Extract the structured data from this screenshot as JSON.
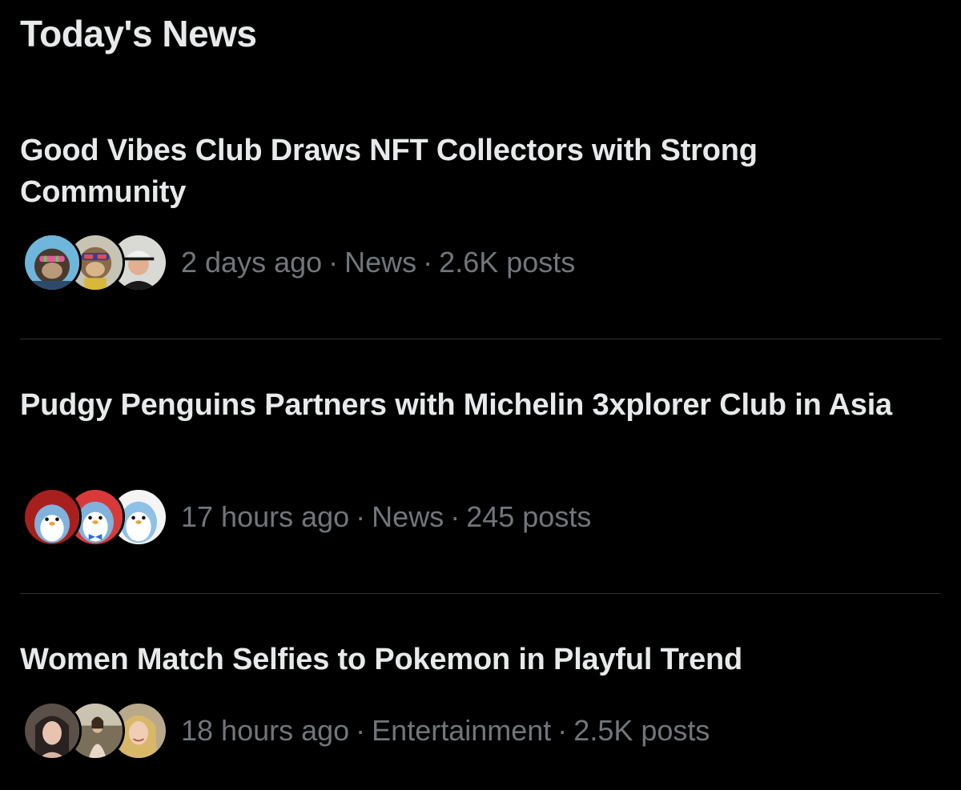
{
  "section_title": "Today's News",
  "separator": "·",
  "items": [
    {
      "headline": "Good Vibes Club Draws NFT Collectors with Strong Community",
      "time": "2 days ago",
      "category": "News",
      "posts": "2.6K posts",
      "avatars": [
        "ape-avatar",
        "ape-glasses-avatar",
        "man-cap-avatar"
      ]
    },
    {
      "headline": "Pudgy Penguins Partners with Michelin 3xplorer Club in Asia",
      "time": "17 hours ago",
      "category": "News",
      "posts": "245 posts",
      "avatars": [
        "penguin-red-avatar",
        "penguin-bowtie-avatar",
        "penguin-light-avatar"
      ]
    },
    {
      "headline": "Women Match Selfies to Pokemon in Playful Trend",
      "time": "18 hours ago",
      "category": "Entertainment",
      "posts": "2.5K posts",
      "avatars": [
        "woman-dark-hair-avatar",
        "woman-photo-avatar",
        "woman-blonde-avatar"
      ]
    }
  ],
  "colors": {
    "background": "#000000",
    "primary_text": "#e7e9ea",
    "secondary_text": "#71767b",
    "divider": "#2f3336"
  }
}
